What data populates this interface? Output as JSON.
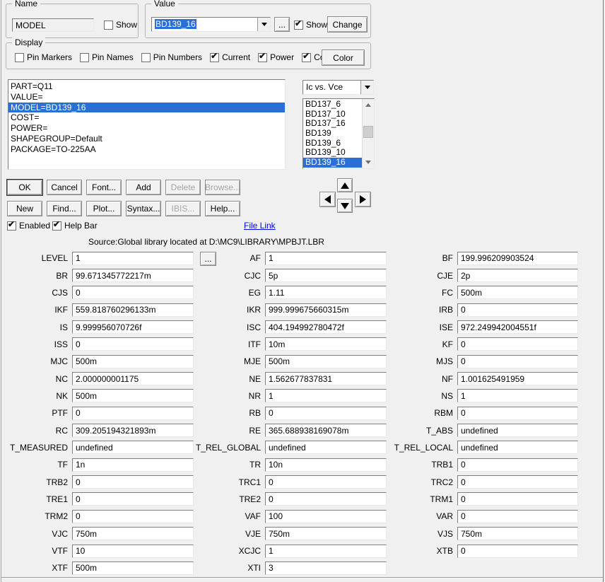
{
  "colors": {
    "selection": "#2a6fd5",
    "link": "#0000ee"
  },
  "icons": {
    "check": "✔"
  },
  "name_group": {
    "title": "Name",
    "value": "MODEL",
    "show_label": "Show",
    "show_checked": false
  },
  "value_group": {
    "title": "Value",
    "combo_value": "BD139_16",
    "more_label": "...",
    "show_label": "Show",
    "show_checked": true,
    "change_label": "Change"
  },
  "display_group": {
    "title": "Display",
    "checkboxes": [
      {
        "label": "Pin Markers",
        "checked": false
      },
      {
        "label": "Pin Names",
        "checked": false
      },
      {
        "label": "Pin Numbers",
        "checked": false
      },
      {
        "label": "Current",
        "checked": true
      },
      {
        "label": "Power",
        "checked": true
      },
      {
        "label": "Condition",
        "checked": true
      }
    ],
    "color_button": "Color"
  },
  "attributes": {
    "items": [
      "PART=Q11",
      "VALUE=",
      "MODEL=BD139_16",
      "COST=",
      "POWER=",
      "SHAPEGROUP=Default",
      "PACKAGE=TO-225AA"
    ],
    "selected_index": 2
  },
  "plot_combo": {
    "value": "Ic vs. Vce"
  },
  "models": {
    "items": [
      "BD137_6",
      "BD137_10",
      "BD137_16",
      "BD139",
      "BD139_6",
      "BD139_10",
      "BD139_16"
    ],
    "selected_index": 6
  },
  "buttons": {
    "row1": [
      {
        "label": "OK",
        "disabled": false,
        "default": true
      },
      {
        "label": "Cancel",
        "disabled": false
      },
      {
        "label": "Font...",
        "disabled": false
      },
      {
        "label": "Add",
        "disabled": false
      },
      {
        "label": "Delete",
        "disabled": true
      },
      {
        "label": "Browse...",
        "disabled": true
      }
    ],
    "row2": [
      {
        "label": "New",
        "disabled": false
      },
      {
        "label": "Find...",
        "disabled": false
      },
      {
        "label": "Plot...",
        "disabled": false
      },
      {
        "label": "Syntax...",
        "disabled": false
      },
      {
        "label": "IBIS...",
        "disabled": true
      },
      {
        "label": "Help...",
        "disabled": false
      }
    ]
  },
  "options": {
    "enabled": {
      "label": "Enabled",
      "checked": true
    },
    "help_bar": {
      "label": "Help Bar",
      "checked": true
    }
  },
  "file_link": "File Link",
  "source_line": "Source:Global library located at D:\\MC9\\LIBRARY\\MPBJT.LBR",
  "params": {
    "more_label": "...",
    "rows": [
      [
        "LEVEL",
        "1",
        "AF",
        "1",
        "BF",
        "199.996209903524"
      ],
      [
        "BR",
        "99.671345772217m",
        "CJC",
        "5p",
        "CJE",
        "2p"
      ],
      [
        "CJS",
        "0",
        "EG",
        "1.11",
        "FC",
        "500m"
      ],
      [
        "IKF",
        "559.818760296133m",
        "IKR",
        "999.999675660315m",
        "IRB",
        "0"
      ],
      [
        "IS",
        "9.999956070726f",
        "ISC",
        "404.194992780472f",
        "ISE",
        "972.249942004551f"
      ],
      [
        "ISS",
        "0",
        "ITF",
        "10m",
        "KF",
        "0"
      ],
      [
        "MJC",
        "500m",
        "MJE",
        "500m",
        "MJS",
        "0"
      ],
      [
        "NC",
        "2.000000001175",
        "NE",
        "1.562677837831",
        "NF",
        "1.001625491959"
      ],
      [
        "NK",
        "500m",
        "NR",
        "1",
        "NS",
        "1"
      ],
      [
        "PTF",
        "0",
        "RB",
        "0",
        "RBM",
        "0"
      ],
      [
        "RC",
        "309.205194321893m",
        "RE",
        "365.688938169078m",
        "T_ABS",
        "undefined"
      ],
      [
        "T_MEASURED",
        "undefined",
        "T_REL_GLOBAL",
        "undefined",
        "T_REL_LOCAL",
        "undefined"
      ],
      [
        "TF",
        "1n",
        "TR",
        "10n",
        "TRB1",
        "0"
      ],
      [
        "TRB2",
        "0",
        "TRC1",
        "0",
        "TRC2",
        "0"
      ],
      [
        "TRE1",
        "0",
        "TRE2",
        "0",
        "TRM1",
        "0"
      ],
      [
        "TRM2",
        "0",
        "VAF",
        "100",
        "VAR",
        "0"
      ],
      [
        "VJC",
        "750m",
        "VJE",
        "750m",
        "VJS",
        "750m"
      ],
      [
        "VTF",
        "10",
        "XCJC",
        "1",
        "XTB",
        "0"
      ],
      [
        "XTF",
        "500m",
        "XTI",
        "3",
        null,
        null
      ]
    ]
  }
}
